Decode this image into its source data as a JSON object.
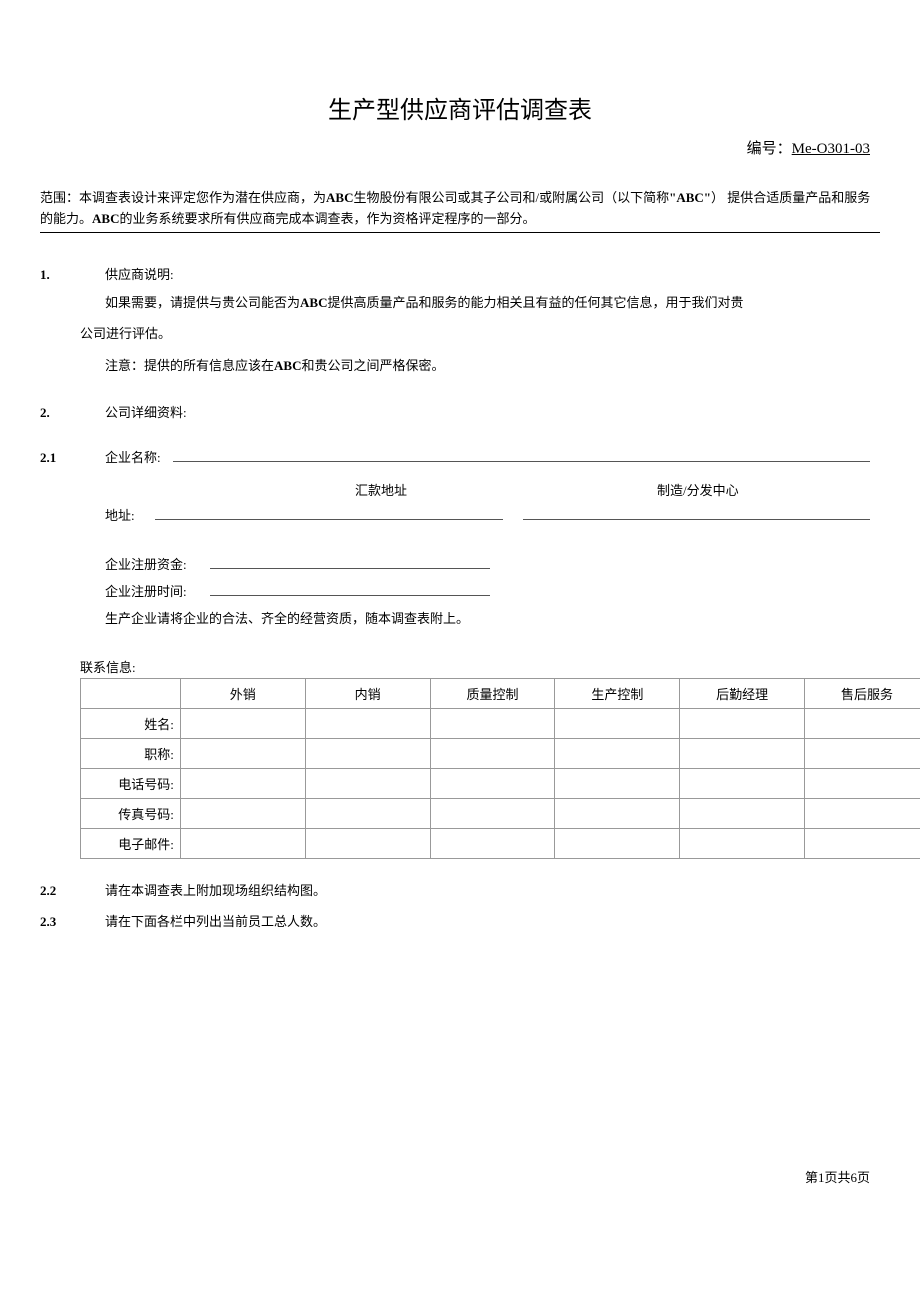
{
  "title": "生产型供应商评估调查表",
  "doc_number_label": "编号：",
  "doc_number": "Me-O301-03",
  "scope": {
    "label": "范围：",
    "text_part1": "本调查表设计来评定您作为潜在供应商，为",
    "abc1": "ABC",
    "text_part2": "生物股份有限公司或其子公司和/或附属公司（以下简称",
    "abc_quote": "\"ABC\"",
    "text_part3": "） 提供合适质量产品和服务的能力。",
    "abc2": "ABC",
    "text_part4": "的业务系统要求所有供应商完成本调查表，作为资格评定程序的一部分。"
  },
  "section1": {
    "num": "1.",
    "heading": "供应商说明:",
    "line1a": "如果需要，请提供与贵公司能否为",
    "abc": "ABC",
    "line1b": "提供高质量产品和服务的能力相关且有益的任何其它信息，用于我们对贵",
    "line2": "公司进行评估。",
    "note_a": "注意：提供的所有信息应该在",
    "note_abc": "ABC",
    "note_b": "和贵公司之间严格保密。"
  },
  "section2": {
    "num": "2.",
    "heading": "公司详细资料:"
  },
  "section2_1": {
    "num": "2.1",
    "company_name_label": "企业名称:",
    "remit_header": "汇款地址",
    "mfg_header": "制造/分发中心",
    "address_label": "地址:",
    "reg_capital_label": "企业注册资金:",
    "reg_time_label": "企业注册时间:",
    "attach_note": "生产企业请将企业的合法、齐全的经营资质，随本调查表附上。",
    "contact_info_label": "联系信息:",
    "columns": [
      "外销",
      "内销",
      "质量控制",
      "生产控制",
      "后勤经理",
      "售后服务"
    ],
    "rows": [
      "姓名:",
      "职称:",
      "电话号码:",
      "传真号码:",
      "电子邮件:"
    ]
  },
  "section2_2": {
    "num": "2.2",
    "text": "请在本调查表上附加现场组织结构图。"
  },
  "section2_3": {
    "num": "2.3",
    "text": "请在下面各栏中列出当前员工总人数。"
  },
  "footer": {
    "prefix": "第",
    "current": "1",
    "mid": "页共",
    "total": "6",
    "suffix": "页"
  }
}
